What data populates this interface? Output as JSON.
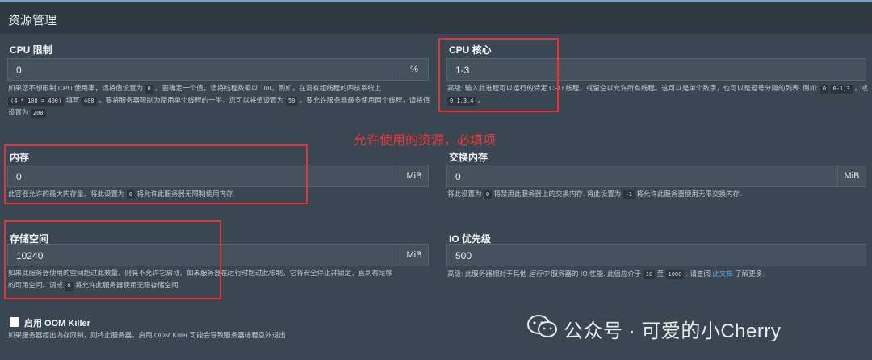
{
  "section_title": "资源管理",
  "cpu_limit": {
    "label": "CPU 限制",
    "value": "0",
    "suffix": "%",
    "help_1": "如果您不想限制 CPU 使用率，请将值设置为",
    "code_0": "0",
    "help_2": "。要确定一个值，请将线程数乘以 100。例如，在没有超线程的四核系统上",
    "code_expr": "(4 * 100 = 400)",
    "help_3": "填写",
    "code_400": "400",
    "help_4": "。要将服务器限制为使用单个线程的一半，您可以将值设置为",
    "code_50": "50",
    "help_5": "。要允许服务器最多使用两个线程，请将值设置为",
    "code_200": "200"
  },
  "cpu_cores": {
    "label": "CPU 核心",
    "value": "1-3",
    "help_1": "高级: 输入此进程可以运行的特定 CPU 线程，或留空以允许所有线程。这可以是单个数字，也可以是逗号分隔的列表. 例如:",
    "code_0": "0",
    "code_range": "0-1,3",
    "help_or": "，或",
    "code_list": "0,1,3,4",
    "help_end": "。"
  },
  "annotation": "允许使用的资源，必填项",
  "memory": {
    "label": "内存",
    "value": "0",
    "suffix": "MiB",
    "help_1": "此容器允许的最大内存量。将此设置为",
    "code_0": "0",
    "help_2": "将允许此服务器无限制使用内存."
  },
  "swap": {
    "label": "交换内存",
    "value": "0",
    "suffix": "MiB",
    "help_1": "将此设置为",
    "code_0": "0",
    "help_2": "将禁用此服务器上的交换内存. 将此设置为",
    "code_neg1": "-1",
    "help_3": "将允许此服务器使用无限交换内存."
  },
  "storage": {
    "label": "存储空间",
    "value": "10240",
    "suffix": "MiB",
    "help_1": "如果此服务器使用的空间超过此数量，则将不允许它启动。如果服务器在运行时超过此限制，它将安全停止并锁定，直到有足够",
    "help_2": "的可用空间。调成",
    "code_0": "0",
    "help_3": "将允许此服务器使用无限存储空间."
  },
  "io": {
    "label": "IO 优先级",
    "value": "500",
    "help_1": "高级: 此服务器相对于其他",
    "help_italic": "运行中",
    "help_2": "服务器的 IO 性能. 此值应介于",
    "code_10": "10",
    "help_3": "至",
    "code_1000": "1000",
    "help_4": ". 请查阅",
    "link": "此文档",
    "help_5": "了解更多."
  },
  "oom": {
    "label": "启用 OOM Killer",
    "help": "如果服务器超出内存限制，则终止服务器。启用 OOM Killer 可能会导致服务器进程意外退出"
  },
  "watermark": {
    "text": "公众号 · 可爱的小Cherry",
    "icon": "wechat-icon"
  },
  "colors": {
    "panel": "#3a4651",
    "input": "#45515c",
    "annotation_red": "#e2353a",
    "link": "#6ea7ea"
  }
}
